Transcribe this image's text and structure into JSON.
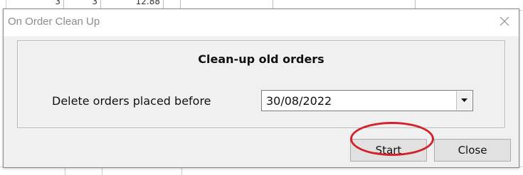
{
  "background_sheet": {
    "cells": [
      "3",
      "3",
      "12.88"
    ]
  },
  "dialog": {
    "title": "On Order Clean Up",
    "close_icon": "close-icon",
    "heading": "Clean-up old orders",
    "field_label": "Delete orders placed before",
    "date_value": "30/08/2022",
    "buttons": {
      "start": "Start",
      "close": "Close"
    }
  },
  "annotation": {
    "shape": "ellipse",
    "color": "#d42028",
    "target": "start-button"
  }
}
